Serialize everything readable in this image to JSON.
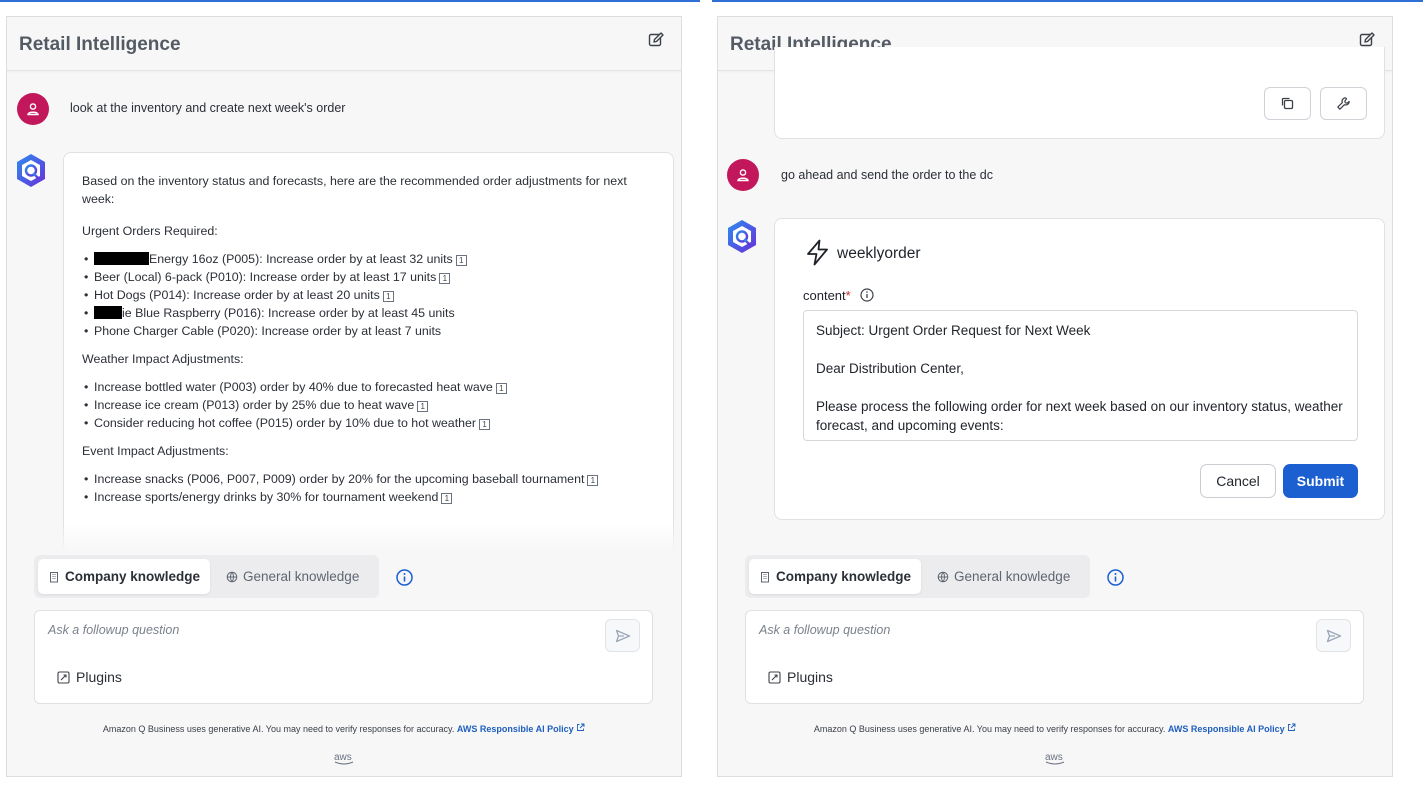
{
  "app": {
    "title": "Retail Intelligence",
    "knowledge": {
      "company": "Company knowledge",
      "general": "General knowledge"
    },
    "input_placeholder": "Ask a followup question",
    "plugins_label": "Plugins",
    "disclaimer": "Amazon Q Business uses generative AI. You may need to verify responses for accuracy.",
    "policy_link": "AWS Responsible AI Policy",
    "aws_logo": "aws"
  },
  "left": {
    "user_message": "look at the inventory and create next week's order",
    "response": {
      "intro": "Based on the inventory status and forecasts, here are the recommended order adjustments for next week:",
      "sections": [
        {
          "heading": "Urgent Orders Required:",
          "items": [
            {
              "redacted": true,
              "text": "Energy 16oz (P005): Increase order by at least 32 units",
              "cite": "1"
            },
            {
              "text": "Beer (Local) 6-pack (P010): Increase order by at least 17 units",
              "cite": "1"
            },
            {
              "text": "Hot Dogs (P014): Increase order by at least 20 units",
              "cite": "1"
            },
            {
              "redacted": true,
              "text": "ie Blue Raspberry (P016): Increase order by at least 45 units",
              "cite": ""
            },
            {
              "text": "Phone Charger Cable (P020): Increase order by at least 7 units",
              "cite": ""
            }
          ]
        },
        {
          "heading": "Weather Impact Adjustments:",
          "items": [
            {
              "text": "Increase bottled water (P003) order by 40% due to forecasted heat wave",
              "cite": "1"
            },
            {
              "text": "Increase ice cream (P013) order by 25% due to heat wave",
              "cite": "1"
            },
            {
              "text": "Consider reducing hot coffee (P015) order by 10% due to hot weather",
              "cite": "1"
            }
          ]
        },
        {
          "heading": "Event Impact Adjustments:",
          "items": [
            {
              "text": "Increase snacks (P006, P007, P009) order by 20% for the upcoming baseball tournament",
              "cite": "1"
            },
            {
              "text": "Increase sports/energy drinks by 30% for tournament weekend",
              "cite": "1"
            }
          ]
        }
      ]
    }
  },
  "right": {
    "user_message": "go ahead and send the order to the dc",
    "form": {
      "title": "weeklyorder",
      "field_label": "content",
      "field_required": "*",
      "paragraphs": [
        "Subject: Urgent Order Request for Next Week",
        "Dear Distribution Center,",
        "Please process the following order for next week based on our inventory status, weather forecast, and upcoming events:"
      ],
      "cancel_label": "Cancel",
      "submit_label": "Submit"
    }
  },
  "colors": {
    "accent": "#1b5fd1",
    "user_avatar": "#c2185b",
    "link": "#1f5fbf"
  }
}
